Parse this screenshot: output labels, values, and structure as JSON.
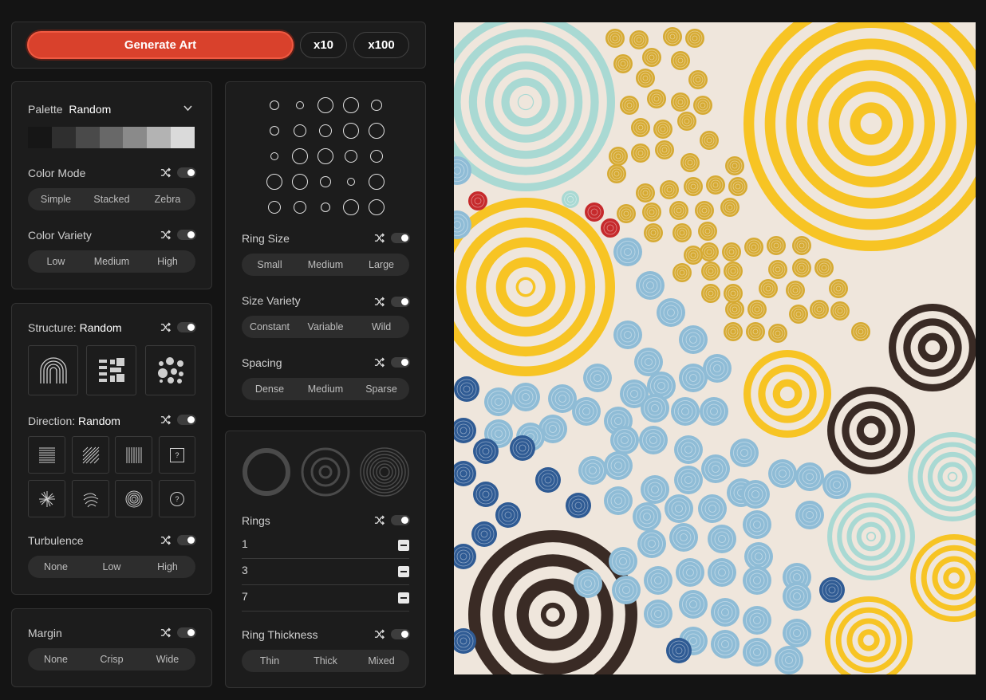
{
  "toolbar": {
    "generate_label": "Generate Art",
    "x10_label": "x10",
    "x100_label": "x100"
  },
  "palette": {
    "label": "Palette",
    "value": "Random",
    "swatches": [
      "#161616",
      "#2f2f2f",
      "#4a4a4a",
      "#686868",
      "#8a8a8a",
      "#b3b3b3",
      "#dadada"
    ]
  },
  "color_mode": {
    "label": "Color Mode",
    "options": [
      "Simple",
      "Stacked",
      "Zebra"
    ]
  },
  "color_variety": {
    "label": "Color Variety",
    "options": [
      "Low",
      "Medium",
      "High"
    ]
  },
  "structure": {
    "label": "Structure:",
    "value": "Random"
  },
  "direction": {
    "label": "Direction:",
    "value": "Random",
    "unknown_glyph": "?"
  },
  "turbulence": {
    "label": "Turbulence",
    "options": [
      "None",
      "Low",
      "High"
    ]
  },
  "margin": {
    "label": "Margin",
    "options": [
      "None",
      "Crisp",
      "Wide"
    ]
  },
  "ring_size": {
    "label": "Ring Size",
    "options": [
      "Small",
      "Medium",
      "Large"
    ]
  },
  "size_variety": {
    "label": "Size Variety",
    "options": [
      "Constant",
      "Variable",
      "Wild"
    ]
  },
  "spacing": {
    "label": "Spacing",
    "options": [
      "Dense",
      "Medium",
      "Sparse"
    ]
  },
  "rings": {
    "label": "Rings",
    "values": [
      "1",
      "3",
      "7"
    ]
  },
  "ring_thickness": {
    "label": "Ring Thickness",
    "options": [
      "Thin",
      "Thick",
      "Mixed"
    ]
  },
  "art": {
    "background": "#efe6dc",
    "colors": {
      "teal": "#a9d9d3",
      "yellow": "#f7c424",
      "gold": "#d6aa33",
      "red": "#c62a2c",
      "blue": "#8fbcd6",
      "navy": "#2f5b94",
      "brown": "#3a2b25",
      "cream": "#efe6dc"
    }
  }
}
